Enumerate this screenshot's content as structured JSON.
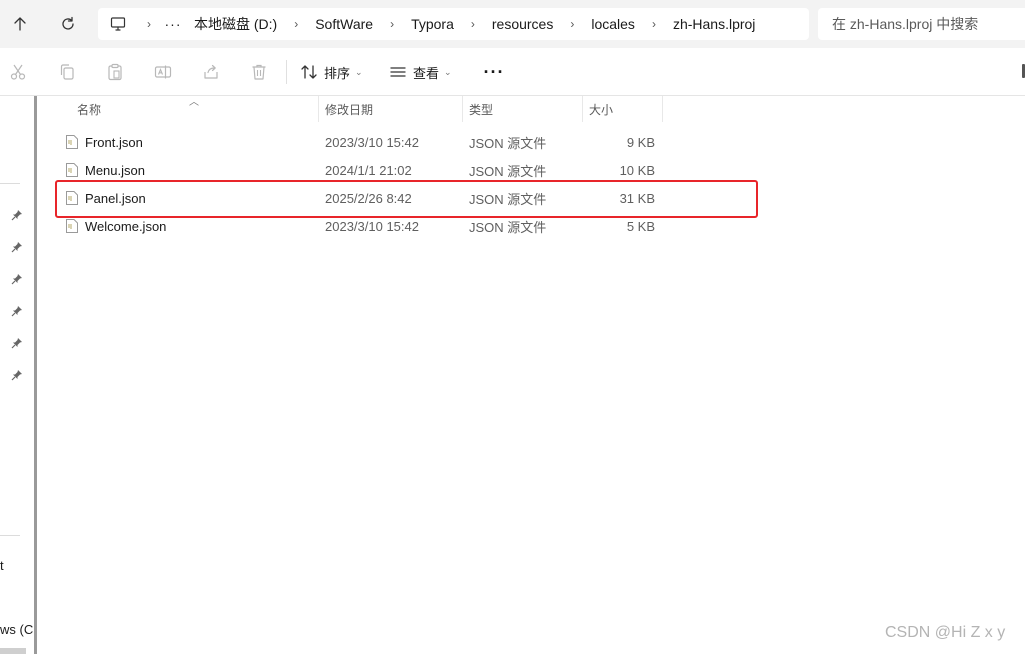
{
  "toolbar": {
    "up_icon": "arrow-up-icon",
    "refresh_icon": "refresh-icon"
  },
  "address": {
    "computer_icon": "monitor-icon",
    "more": "···",
    "separator": "›",
    "segments": [
      "本地磁盘 (D:)",
      "SoftWare",
      "Typora",
      "resources",
      "locales",
      "zh-Hans.lproj"
    ]
  },
  "search": {
    "placeholder": "在 zh-Hans.lproj 中搜索"
  },
  "commands": {
    "cut_icon": "scissors-icon",
    "copy_icon": "copy-icon",
    "paste_icon": "paste-icon",
    "rename_icon": "rename-icon",
    "share_icon": "share-icon",
    "delete_icon": "trash-icon",
    "sort_label": "排序",
    "view_label": "查看",
    "more_label": "···"
  },
  "nav": {
    "pin_count": 6,
    "cut_text_1": "t",
    "cut_text_2": "ws (C"
  },
  "columns": {
    "name": "名称",
    "date": "修改日期",
    "type": "类型",
    "size": "大小"
  },
  "files": [
    {
      "name": "Front.json",
      "date": "2023/3/10 15:42",
      "type": "JSON 源文件",
      "size": "9 KB"
    },
    {
      "name": "Menu.json",
      "date": "2024/1/1 21:02",
      "type": "JSON 源文件",
      "size": "10 KB"
    },
    {
      "name": "Panel.json",
      "date": "2025/2/26 8:42",
      "type": "JSON 源文件",
      "size": "31 KB"
    },
    {
      "name": "Welcome.json",
      "date": "2023/3/10 15:42",
      "type": "JSON 源文件",
      "size": "5 KB"
    }
  ],
  "highlight": {
    "color": "#e8252a",
    "file": "Panel.json"
  },
  "watermark": "CSDN @Hi Z x y"
}
